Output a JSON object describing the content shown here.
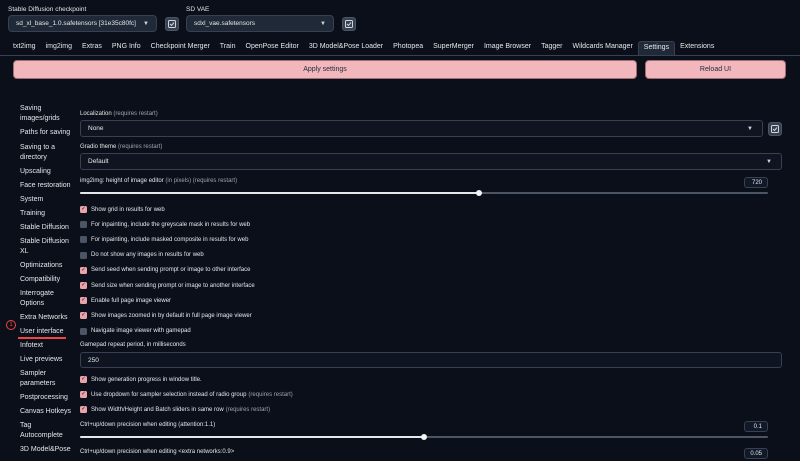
{
  "header": {
    "checkpoint_label": "Stable Diffusion checkpoint",
    "checkpoint_value": "sd_xl_base_1.0.safetensors [31e35c80fc]",
    "vae_label": "SD VAE",
    "vae_value": "sdxl_vae.safetensors"
  },
  "tabs": [
    "txt2img",
    "img2img",
    "Extras",
    "PNG Info",
    "Checkpoint Merger",
    "Train",
    "OpenPose Editor",
    "3D Model&Pose Loader",
    "Photopea",
    "SuperMerger",
    "Image Browser",
    "Tagger",
    "Wildcards Manager",
    "Settings",
    "Extensions"
  ],
  "active_tab": "Settings",
  "buttons": {
    "apply": "Apply settings",
    "reload": "Reload UI"
  },
  "sidebar": {
    "items": [
      "Saving images/grids",
      "Paths for saving",
      "Saving to a directory",
      "Upscaling",
      "Face restoration",
      "System",
      "Training",
      "Stable Diffusion",
      "Stable Diffusion XL",
      "Optimizations",
      "Compatibility",
      "Interrogate Options",
      "Extra Networks",
      "User interface",
      "Infotext",
      "Live previews",
      "Sampler parameters",
      "Postprocessing",
      "Canvas Hotkeys",
      "Tag Autocomplete",
      "3D Model&Pose"
    ],
    "selected": "User interface",
    "annotation_marker": "1"
  },
  "settings": {
    "localization": {
      "label": "Localization",
      "hint": "(requires restart)",
      "value": "None"
    },
    "gradio_theme": {
      "label": "Gradio theme",
      "hint": "(requires restart)",
      "value": "Default"
    },
    "img2img_height": {
      "label": "img2img: height of image editor",
      "hint": "(in pixels) (requires restart)",
      "value": "720",
      "fraction": 0.58
    },
    "checkboxes_a": [
      {
        "label": "Show grid in results for web",
        "hint": "",
        "checked": true
      },
      {
        "label": "For inpainting, include the greyscale mask in results for web",
        "hint": "",
        "checked": false
      },
      {
        "label": "For inpainting, include masked composite in results for web",
        "hint": "",
        "checked": false
      },
      {
        "label": "Do not show any images in results for web",
        "hint": "",
        "checked": false
      },
      {
        "label": "Send seed when sending prompt or image to other interface",
        "hint": "",
        "checked": true
      },
      {
        "label": "Send size when sending prompt or image to another interface",
        "hint": "",
        "checked": true
      },
      {
        "label": "Enable full page image viewer",
        "hint": "",
        "checked": true
      },
      {
        "label": "Show images zoomed in by default in full page image viewer",
        "hint": "",
        "checked": true
      },
      {
        "label": "Navigate image viewer with gamepad",
        "hint": "",
        "checked": false
      }
    ],
    "gamepad": {
      "label": "Gamepad repeat period, in milliseconds",
      "value": "250"
    },
    "checkboxes_b": [
      {
        "label": "Show generation progress in window title.",
        "hint": "",
        "checked": true
      },
      {
        "label": "Use dropdown for sampler selection instead of radio group",
        "hint": "(requires restart)",
        "checked": true
      },
      {
        "label": "Show Width/Height and Batch sliders in same row",
        "hint": "(requires restart)",
        "checked": true
      }
    ],
    "ctrl_attention": {
      "label": "Ctrl+up/down precision when editing (attention:1.1)",
      "value": "0.1",
      "fraction": 0.5
    },
    "ctrl_extra": {
      "label": "Ctrl+up/down precision when editing <extra networks:0.9>",
      "value": "0.05"
    }
  },
  "colors": {
    "background": "#0b0f19",
    "accent": "#f2b7bc",
    "checkbox_on": "#e9a3aa",
    "marker": "#ef4444"
  }
}
